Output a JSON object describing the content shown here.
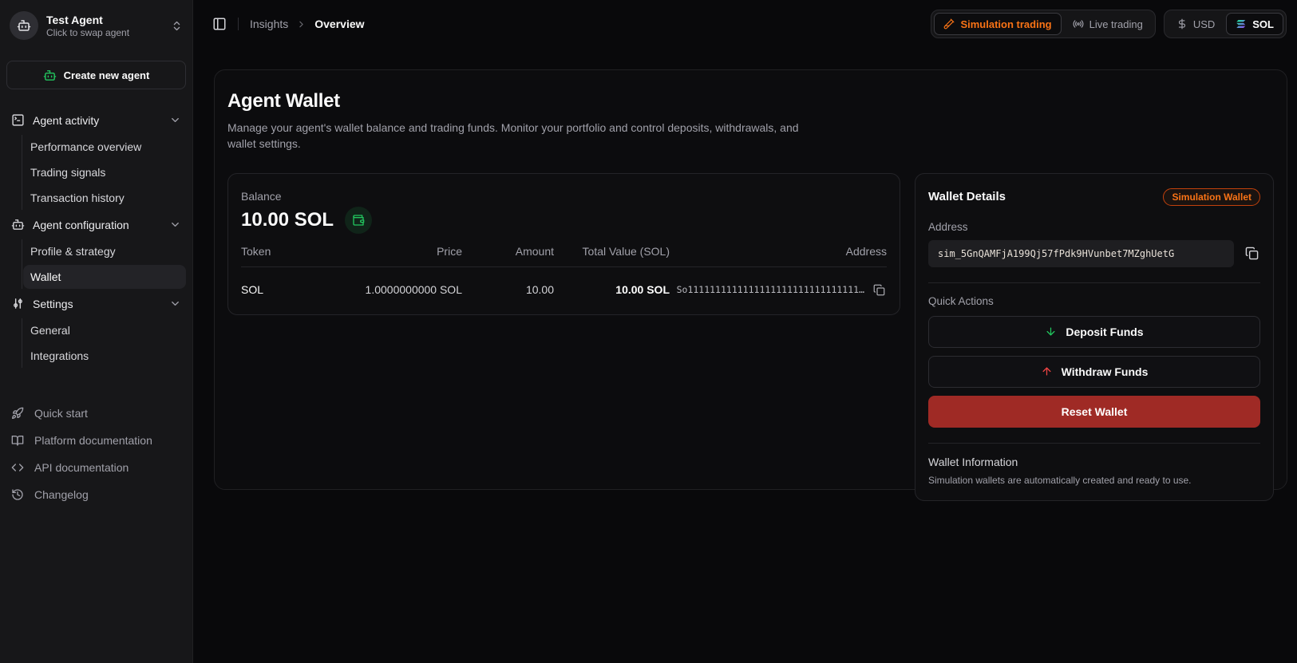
{
  "sidebar": {
    "agent": {
      "name": "Test Agent",
      "subtitle": "Click to swap agent",
      "avatar_icon": "bot-icon",
      "switcher_icon": "chevrons-up-down-icon"
    },
    "create_agent": {
      "label": "Create new agent",
      "icon": "bot-icon"
    },
    "sections": [
      {
        "label": "Agent activity",
        "icon": "terminal-icon",
        "chevron_icon": "chevron-down-icon",
        "children": [
          "Performance overview",
          "Trading signals",
          "Transaction history"
        ]
      },
      {
        "label": "Agent configuration",
        "icon": "bot-icon",
        "chevron_icon": "chevron-down-icon",
        "children": [
          "Profile & strategy",
          "Wallet"
        ]
      },
      {
        "label": "Settings",
        "icon": "sliders-icon",
        "chevron_icon": "chevron-down-icon",
        "children": [
          "General",
          "Integrations"
        ]
      }
    ],
    "active_item": "Wallet",
    "footer_links": [
      {
        "label": "Quick start",
        "icon": "rocket-icon"
      },
      {
        "label": "Platform documentation",
        "icon": "book-open-icon"
      },
      {
        "label": "API documentation",
        "icon": "code-icon"
      },
      {
        "label": "Changelog",
        "icon": "history-icon"
      }
    ]
  },
  "topbar": {
    "sidebar_toggle_icon": "panel-left-icon",
    "breadcrumb": {
      "parent": "Insights",
      "current": "Overview"
    },
    "trading_toggle": {
      "simulation": {
        "label": "Simulation trading",
        "icon": "test-tube-icon",
        "active": true
      },
      "live": {
        "label": "Live trading",
        "icon": "radio-icon",
        "active": false
      }
    },
    "currency_toggle": {
      "usd": {
        "label": "USD",
        "icon": "dollar-icon",
        "active": false
      },
      "sol": {
        "label": "SOL",
        "icon": "solana-icon",
        "active": true
      }
    }
  },
  "main": {
    "title": "Agent Wallet",
    "description": "Manage your agent's wallet balance and trading funds. Monitor your portfolio and control deposits, withdrawals, and wallet settings.",
    "balance_card": {
      "label": "Balance",
      "value": "10.00 SOL",
      "wallet_icon": "wallet-icon",
      "table": {
        "headers": [
          "Token",
          "Price",
          "Amount",
          "Total Value (SOL)",
          "Address"
        ],
        "rows": [
          {
            "token": "SOL",
            "price": "1.0000000000 SOL",
            "amount": "10.00",
            "total_value": "10.00 SOL",
            "address": "So1111111111111111111111111111111…",
            "copy_icon": "copy-icon"
          }
        ]
      }
    },
    "wallet_details": {
      "title": "Wallet Details",
      "badge": "Simulation Wallet",
      "address_label": "Address",
      "address_value": "sim_5GnQAMFjA199Qj57fPdk9HVunbet7MZghUetG",
      "copy_icon": "copy-icon",
      "quick_actions_label": "Quick Actions",
      "deposit": {
        "label": "Deposit Funds",
        "icon": "arrow-down-icon"
      },
      "withdraw": {
        "label": "Withdraw Funds",
        "icon": "arrow-up-icon"
      },
      "reset": {
        "label": "Reset Wallet"
      },
      "info_title": "Wallet Information",
      "info_text": "Simulation wallets are automatically created and ready to use."
    }
  },
  "colors": {
    "accent_orange": "#f97316",
    "green": "#22c55e",
    "red": "#ef4444",
    "reset_red": "#9f2a25",
    "badge_border": "#c2410c"
  }
}
